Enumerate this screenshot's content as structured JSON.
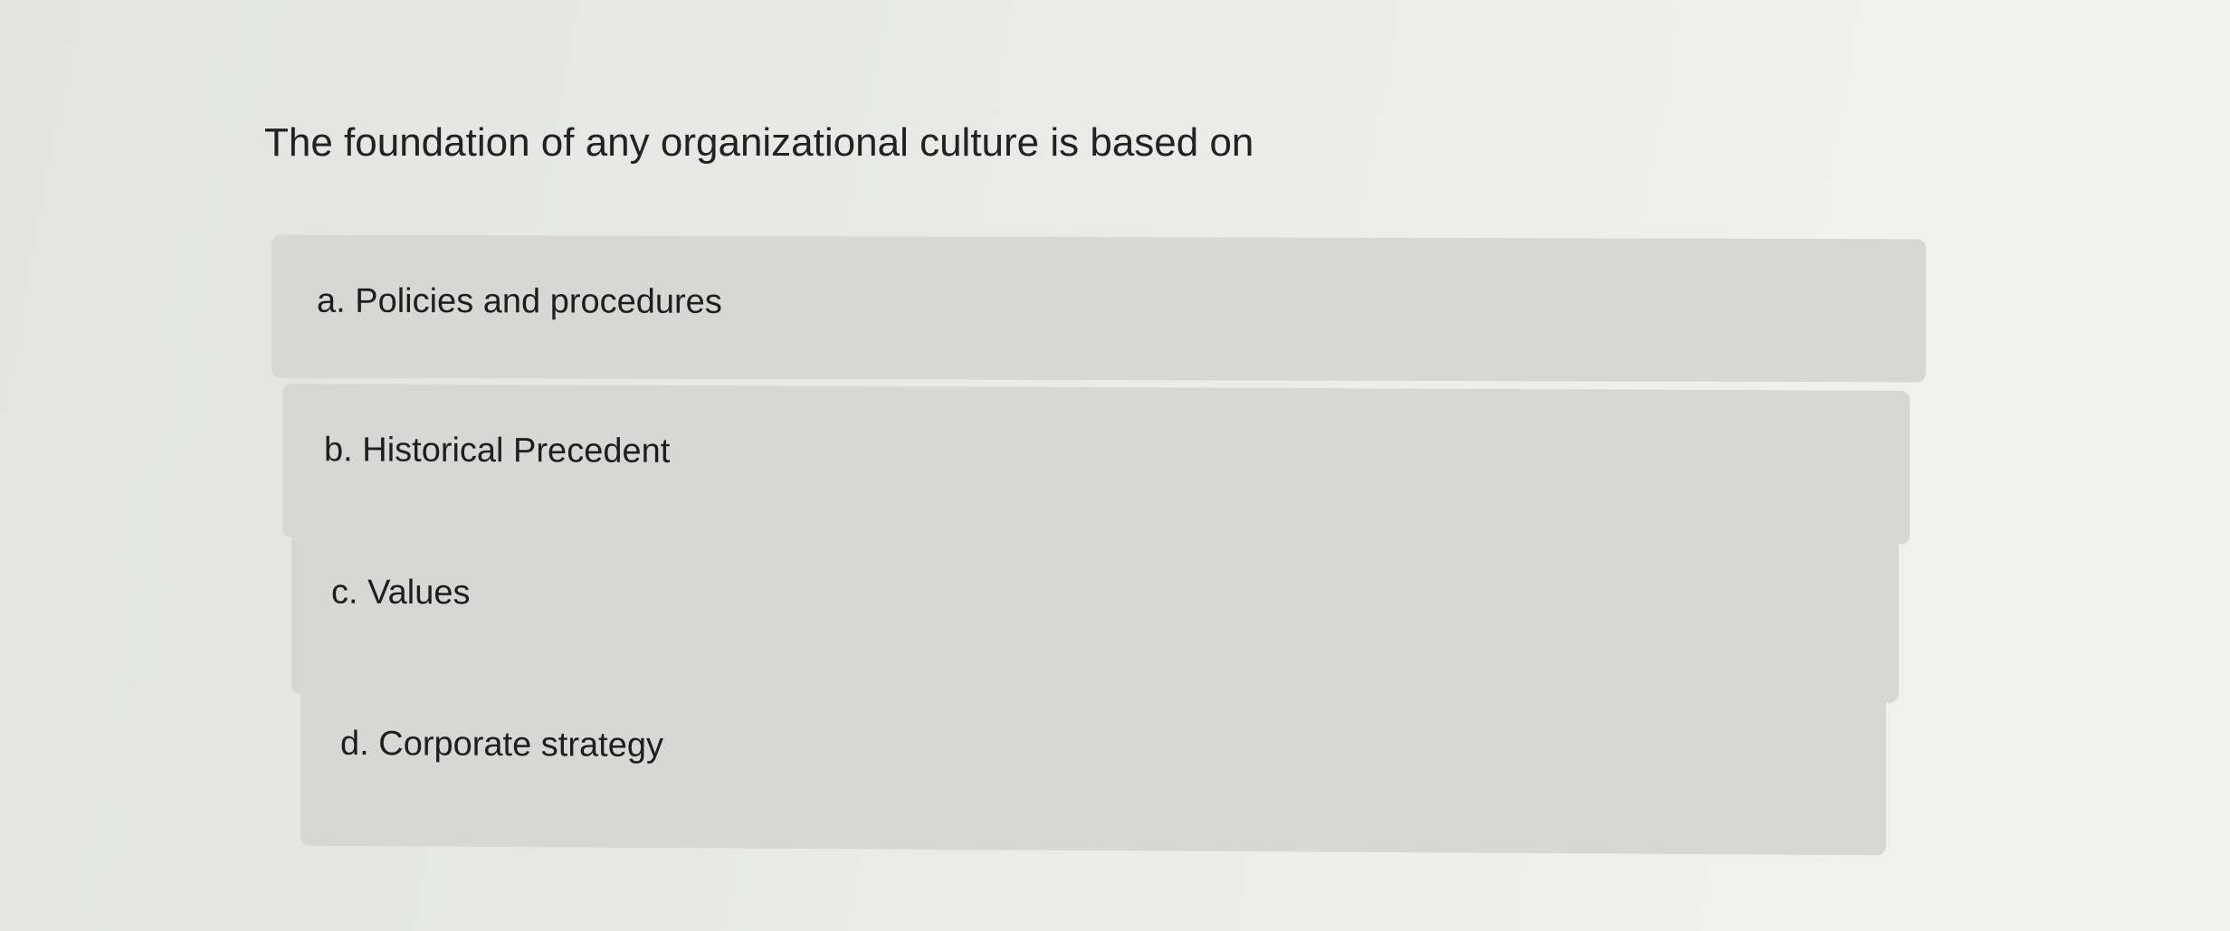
{
  "question": {
    "text": "The foundation of any organizational culture is based on"
  },
  "options": [
    {
      "letter": "a",
      "label": "a. Policies and procedures"
    },
    {
      "letter": "b",
      "label": "b. Historical Precedent"
    },
    {
      "letter": "c",
      "label": "c. Values"
    },
    {
      "letter": "d",
      "label": "d. Corporate strategy"
    }
  ],
  "colors": {
    "background": "#e8e9e7",
    "option_background": "#d7d8d6",
    "text": "#1e1e1e"
  }
}
